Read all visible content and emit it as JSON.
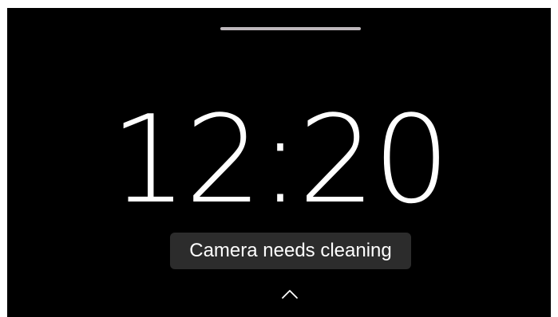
{
  "clock": {
    "time": "12:20"
  },
  "notification": {
    "message": "Camera needs cleaning"
  },
  "icons": {
    "top_handle": "drag-handle-bar",
    "bottom": "chevron-up-icon"
  },
  "colors": {
    "background": "#000000",
    "text": "#ffffff",
    "toast_background": "#2c2c2c",
    "handle": "#bdb7bb"
  }
}
